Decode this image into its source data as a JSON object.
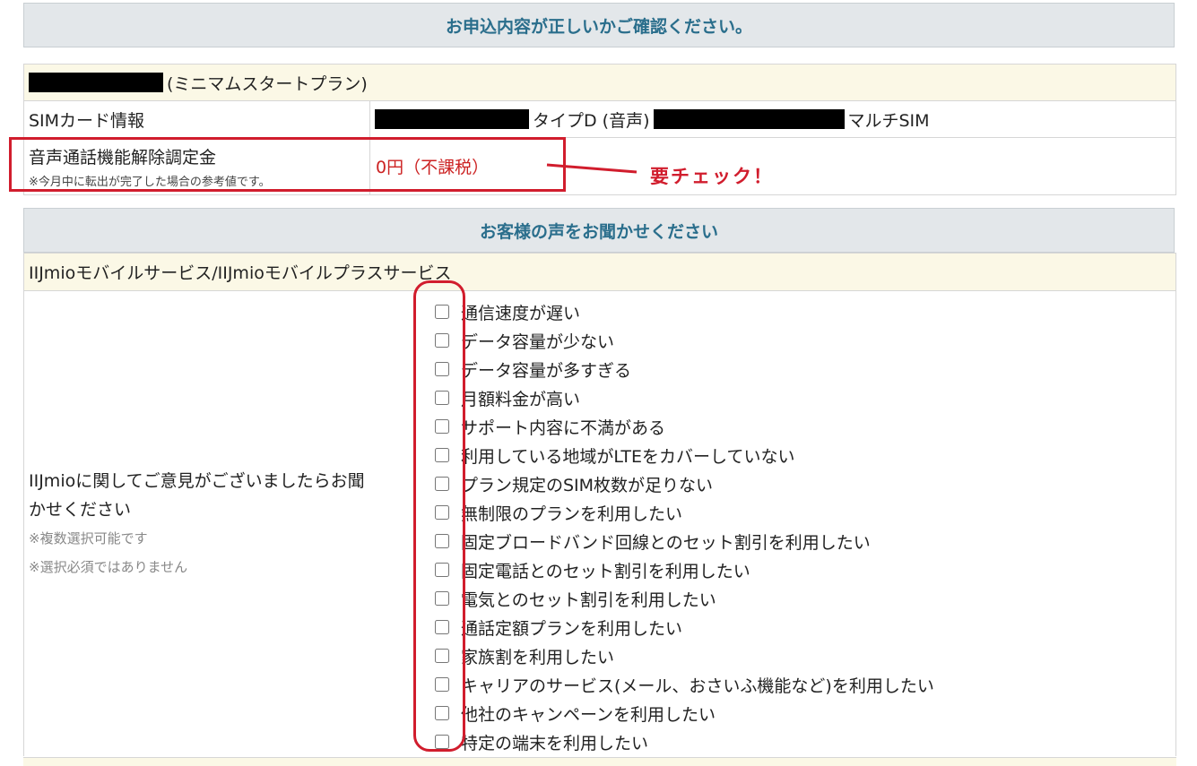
{
  "header1": "お申込内容が正しいかご確認ください。",
  "plan": {
    "suffix": "(ミニマムスタートプラン)"
  },
  "sim": {
    "label": "SIMカード情報",
    "type_text": "タイプD (音声)",
    "multi_text": "マルチSIM"
  },
  "fee": {
    "label": "音声通話機能解除調定金",
    "note": "※今月中に転出が完了した場合の参考値です。",
    "value": "0円（不課税）"
  },
  "annotation": {
    "label": "要チェック！"
  },
  "header2": "お客様の声をお聞かせください",
  "service_row": "IIJmioモバイルサービス/IIJmioモバイルプラスサービス",
  "survey": {
    "question_line1": "IIJmioに関してご意見がございましたらお聞",
    "question_line2": "かせください",
    "note1": "※複数選択可能です",
    "note2": "※選択必須ではありません",
    "options": [
      "通信速度が遅い",
      "データ容量が少ない",
      "データ容量が多すぎる",
      "月額料金が高い",
      "サポート内容に不満がある",
      "利用している地域がLTEをカバーしていない",
      "プラン規定のSIM枚数が足りない",
      "無制限のプランを利用したい",
      "固定ブロードバンド回線とのセット割引を利用したい",
      "固定電話とのセット割引を利用したい",
      "電気とのセット割引を利用したい",
      "通話定額プランを利用したい",
      "家族割を利用したい",
      "キャリアのサービス(メール、おさいふ機能など)を利用したい",
      "他社のキャンペーンを利用したい",
      "特定の端末を利用したい"
    ]
  },
  "colors": {
    "header_text": "#2a6e8c",
    "header_bg": "#e3e7ea",
    "cream_bg": "#fbf8e6",
    "annotation_red": "#d11d2d",
    "value_red": "#cc2222"
  }
}
